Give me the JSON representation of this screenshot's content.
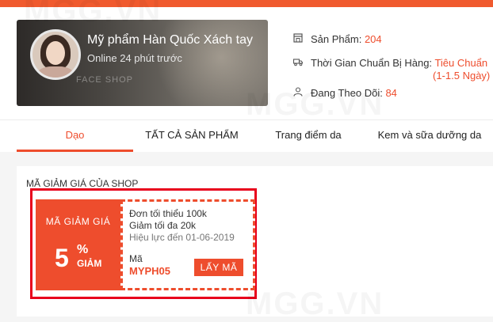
{
  "header": {
    "shop_name": "Mỹ phẩm Hàn Quốc Xách tay",
    "status": "Online 24 phút trước",
    "banner_text": "FACE SHOP",
    "stats": {
      "products_label": "Sản Phẩm: ",
      "products_value": "204",
      "prep_label": "Thời Gian Chuẩn Bị Hàng: ",
      "prep_value": "Tiêu Chuẩn",
      "prep_value_2": "(1-1.5 Ngày)",
      "following_label": "Đang Theo Dõi: ",
      "following_value": "84"
    }
  },
  "nav": {
    "tabs": [
      {
        "label": "Dạo",
        "active": true
      },
      {
        "label": "TẤT CẢ SẢN PHẨM",
        "active": false
      },
      {
        "label": "Trang điểm da",
        "active": false
      },
      {
        "label": "Kem và sữa dưỡng da",
        "active": false
      }
    ]
  },
  "vouchers": {
    "section_title": "MÃ GIẢM GIÁ CỦA SHOP",
    "item": {
      "badge": "MÃ GIẢM GIÁ",
      "discount_value": "5",
      "discount_unit_symbol": "%",
      "discount_unit_label": "GIẢM",
      "min_order": "Đơn tối thiểu 100k",
      "max_discount": "Giảm tối đa 20k",
      "valid_until": "Hiệu lực đến 01-06-2019",
      "code_label": "Mã",
      "code": "MYPH05",
      "claim_button": "LẤY MÃ"
    }
  },
  "watermark": "MGG.VN",
  "colors": {
    "accent": "#ee4d2d",
    "highlight_border": "#e8001c",
    "top_bar": "#f05a2e"
  }
}
